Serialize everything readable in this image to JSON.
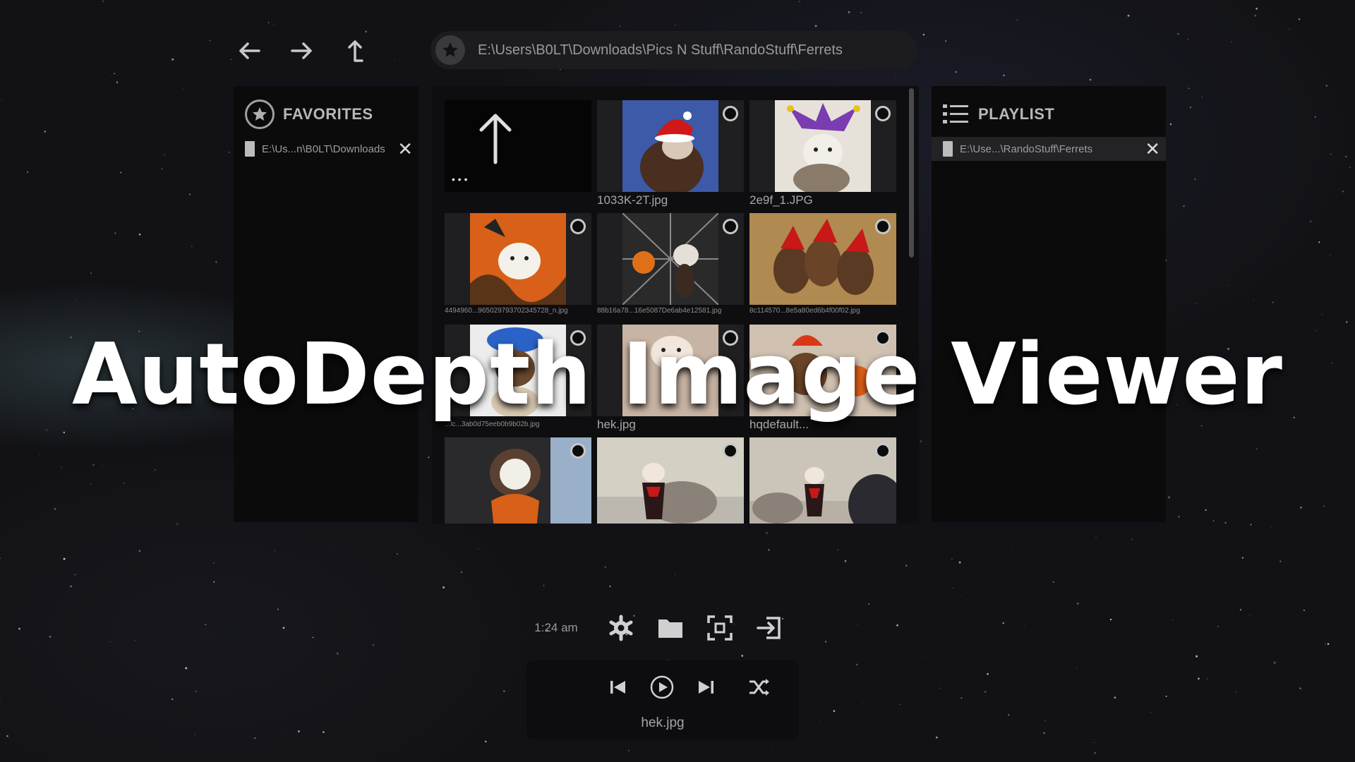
{
  "nav": {
    "back_icon": "arrow-left-icon",
    "forward_icon": "arrow-right-icon",
    "parent_icon": "parent-folder-icon"
  },
  "path_bar": {
    "path": "E:\\Users\\B0LT\\Downloads\\Pics N Stuff\\RandoStuff\\Ferrets",
    "favorite_icon": "star-icon"
  },
  "favorites": {
    "title": "FAVORITES",
    "items": [
      {
        "label": "E:\\Us...n\\B0LT\\Downloads"
      }
    ]
  },
  "playlist": {
    "title": "PLAYLIST",
    "items": [
      {
        "label": "E:\\Use...\\RandoStuff\\Ferrets"
      }
    ]
  },
  "grid": {
    "up_tile": {
      "icon": "arrow-up-icon",
      "dots": "• • •"
    },
    "files": [
      {
        "name": "1033K-2T.jpg"
      },
      {
        "name": "2e9f_1.JPG"
      },
      {
        "name": "4494960...96502979370234572​8_n.jpg"
      },
      {
        "name": "88b16a78...16e5087De6ab4e12581.jpg"
      },
      {
        "name": "8c114570...8e5a80ed6b4f00f02.jpg"
      },
      {
        "name": "...lc...3ab0d75eeb0b9b02b.jpg"
      },
      {
        "name": "hek.jpg"
      },
      {
        "name": "hqdefault..."
      },
      {
        "name": ""
      },
      {
        "name": ""
      },
      {
        "name": ""
      }
    ]
  },
  "overlay": {
    "title": "AutoDepth Image Viewer"
  },
  "toolbar": {
    "time": "1:24 am",
    "icons": [
      "gear-icon",
      "folder-icon",
      "fullscreen-icon",
      "exit-icon"
    ]
  },
  "player": {
    "now_playing": "hek.jpg",
    "icons": [
      "previous-icon",
      "play-icon",
      "next-icon",
      "shuffle-icon"
    ]
  },
  "colors": {
    "background": "#121216",
    "panel": "#0b0b0c",
    "tile": "#1f1f21",
    "text": "#a8a8a8",
    "title": "#ffffff"
  }
}
